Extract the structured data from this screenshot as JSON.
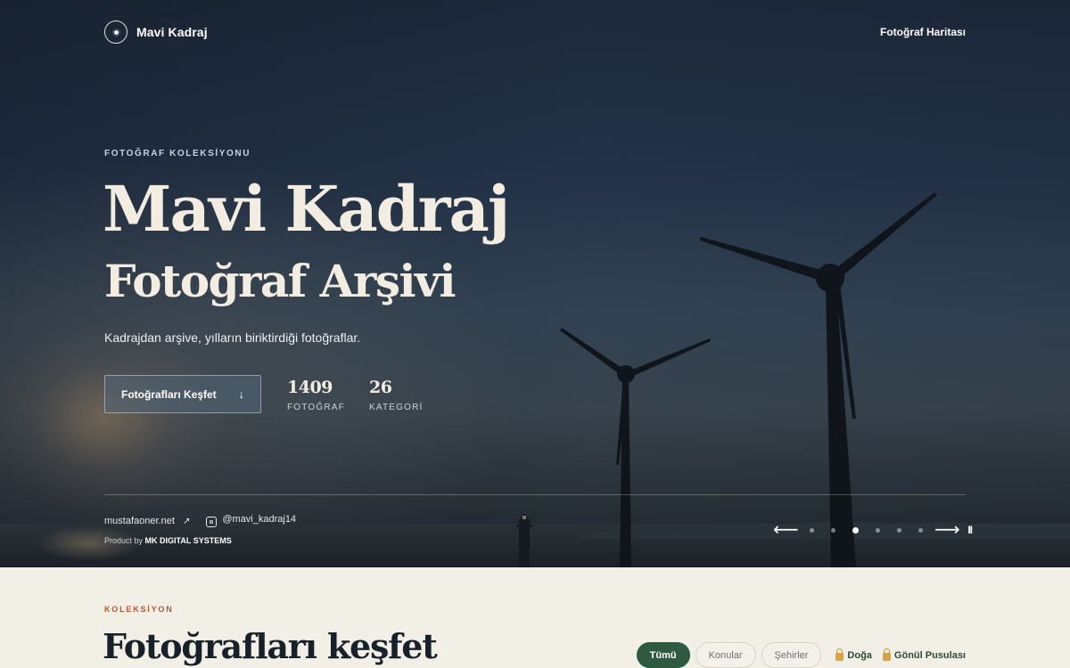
{
  "header": {
    "brand_name": "Mavi Kadraj",
    "nav_link": "Fotoğraf Haritası"
  },
  "hero": {
    "eyebrow": "FOTOĞRAF KOLEKSİYONU",
    "title": "Mavi Kadraj",
    "subtitle": "Fotoğraf Arşivi",
    "tagline": "Kadrajdan arşive, yılların biriktirdiği fotoğraflar.",
    "cta_label": "Fotoğrafları Keşfet",
    "cta_icon": "arrow-down-icon",
    "stats": [
      {
        "value": "1409",
        "label": "FOTOĞRAF"
      },
      {
        "value": "26",
        "label": "KATEGORİ"
      }
    ],
    "website_link": "mustafaoner.net",
    "website_icon": "external-link-icon",
    "instagram_handle": "@mavi_kadraj14",
    "product_prefix": "Product by",
    "product_company": "MK DIGITAL SYSTEMS",
    "slider": {
      "prev_icon": "arrow-left-icon",
      "next_icon": "arrow-right-icon",
      "pause_icon": "pause-icon",
      "slide_count": 6,
      "active_index": 2
    }
  },
  "collection": {
    "label": "KOLEKSİYON",
    "title": "Fotoğrafları keşfet",
    "filters": [
      {
        "label": "Tümü",
        "active": true
      },
      {
        "label": "Konular",
        "active": false
      },
      {
        "label": "Şehirler",
        "active": false
      }
    ],
    "locked_filters": [
      {
        "label": "Doğa",
        "icon": "lock-icon"
      },
      {
        "label": "Gönül Pusulası",
        "icon": "lock-icon"
      }
    ]
  },
  "colors": {
    "accent_green": "#2f5a42",
    "label_orange": "#b45a2e",
    "page_background": "#f2efe7",
    "lock_gold": "#d9a24a"
  }
}
